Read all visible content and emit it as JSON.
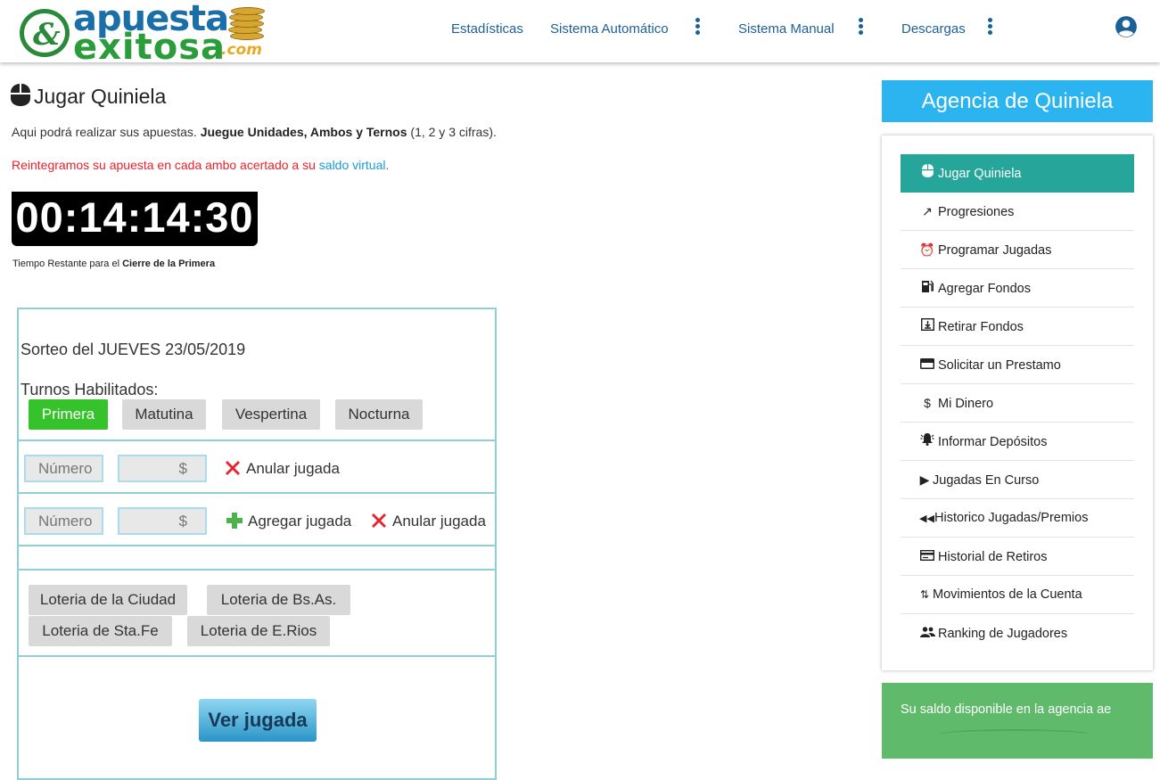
{
  "header": {
    "logo_top": "apuesta",
    "logo_bottom": "exitosa",
    "logo_com": ".com",
    "nav": [
      "Estadísticas",
      "Sistema Automático",
      "Sistema Manual",
      "Descargas"
    ]
  },
  "page": {
    "title": "Jugar Quiniela",
    "intro_prefix": "Aqui podrá realizar sus apuestas. ",
    "intro_bold": "Juegue Unidades, Ambos y Ternos",
    "intro_suffix": " (1, 2 y 3 cifras).",
    "notice_prefix": "Reintegramos su apuesta en cada ambo acertado a su ",
    "notice_link": "saldo virtual",
    "notice_suffix": ".",
    "timer": "00:14:14:30",
    "timer_caption_prefix": "Tiempo Restante para el ",
    "timer_caption_bold": "Cierre de la Primera"
  },
  "form": {
    "draw_date": "Sorteo del JUEVES 23/05/2019",
    "turnos_label": "Turnos Habilitados:",
    "turnos": [
      "Primera",
      "Matutina",
      "Vespertina",
      "Nocturna"
    ],
    "active_turno": "Primera",
    "numero_placeholder": "Número",
    "monto_placeholder": "$",
    "anular_label": "Anular jugada",
    "agregar_label": "Agregar jugada",
    "loterias": [
      "Loteria de la Ciudad",
      "Loteria de Bs.As.",
      "Loteria de Sta.Fe",
      "Loteria de E.Rios"
    ],
    "ver_jugada": "Ver jugada"
  },
  "sidebar": {
    "title": "Agencia de Quiniela",
    "items": [
      {
        "label": "Jugar Quiniela",
        "icon": "mouse-icon"
      },
      {
        "label": "Progresiones",
        "icon": "trending-up-icon"
      },
      {
        "label": "Programar Jugadas",
        "icon": "alarm-clock-icon"
      },
      {
        "label": "Agregar Fondos",
        "icon": "fuel-pump-icon"
      },
      {
        "label": "Retirar Fondos",
        "icon": "download-box-icon"
      },
      {
        "label": "Solicitar un Prestamo",
        "icon": "credit-card-icon"
      },
      {
        "label": "Mi Dinero",
        "icon": "dollar-icon"
      },
      {
        "label": "Informar Depósitos",
        "icon": "alert-bell-icon"
      },
      {
        "label": "Jugadas En Curso",
        "icon": "play-icon"
      },
      {
        "label": "Historico Jugadas/Premios",
        "icon": "rewind-icon"
      },
      {
        "label": "Historial de Retiros",
        "icon": "card-history-icon"
      },
      {
        "label": "Movimientos de la Cuenta",
        "icon": "swap-vertical-icon"
      },
      {
        "label": "Ranking de Jugadores",
        "icon": "people-icon"
      }
    ],
    "saldo_text": "Su saldo disponible en la agencia ae"
  },
  "colors": {
    "accent_teal": "#26a69a",
    "agency_blue": "#2bb4f0",
    "active_green": "#35c22a",
    "notice_red": "#e8212d",
    "saldo_green": "#5fbb6b"
  }
}
